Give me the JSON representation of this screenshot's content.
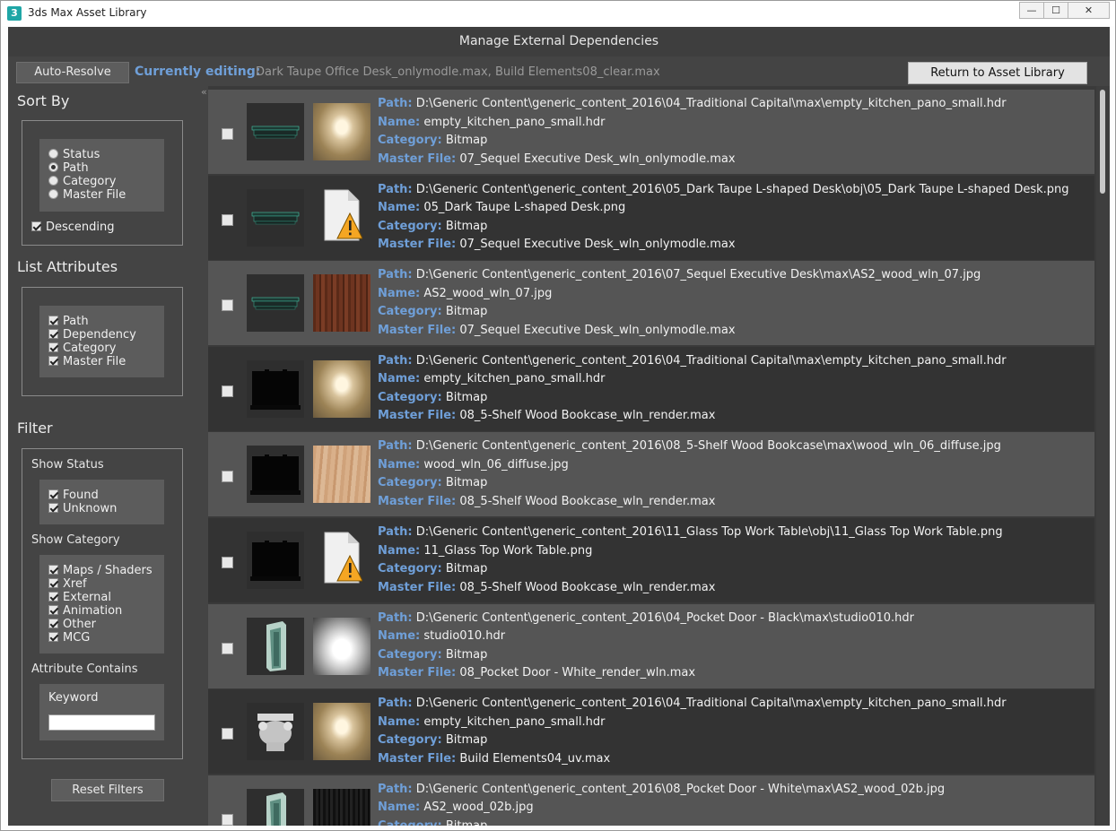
{
  "window": {
    "title": "3ds Max Asset Library",
    "app_icon": "3",
    "controls": {
      "minimize": "—",
      "maximize": "☐",
      "close": "✕"
    }
  },
  "header": {
    "title": "Manage External Dependencies"
  },
  "toolbar": {
    "auto_resolve_label": "Auto-Resolve",
    "editing_label": "Currently editing:",
    "editing_value": "Dark Taupe Office Desk_onlymodle.max, Build Elements08_clear.max",
    "return_label": "Return to Asset Library"
  },
  "sidebar": {
    "sort_by": {
      "title": "Sort By",
      "options": [
        "Status",
        "Path",
        "Category",
        "Master File"
      ],
      "selected": "Path",
      "descending_label": "Descending"
    },
    "list_attributes": {
      "title": "List Attributes",
      "items": [
        "Path",
        "Dependency",
        "Category",
        "Master File"
      ]
    },
    "filter": {
      "title": "Filter",
      "show_status_label": "Show Status",
      "status_items": [
        "Found",
        "Unknown"
      ],
      "show_category_label": "Show Category",
      "category_items": [
        "Maps / Shaders",
        "Xref",
        "External",
        "Animation",
        "Other",
        "MCG"
      ],
      "attribute_contains_label": "Attribute Contains",
      "keyword_label": "Keyword",
      "keyword_value": "",
      "reset_label": "Reset Filters"
    }
  },
  "list": {
    "collapse_glyph": "«",
    "keys": {
      "path": "Path:",
      "name": "Name:",
      "category": "Category:",
      "master": "Master File:"
    },
    "rows": [
      {
        "path": "D:\\Generic Content\\generic_content_2016\\04_Traditional Capital\\max\\empty_kitchen_pano_small.hdr",
        "name": "empty_kitchen_pano_small.hdr",
        "category": "Bitmap",
        "master": "07_Sequel Executive Desk_wln_onlymodle.max",
        "obj": "desk",
        "tex": "pano"
      },
      {
        "path": "D:\\Generic Content\\generic_content_2016\\05_Dark Taupe L-shaped Desk\\obj\\05_Dark Taupe L-shaped Desk.png",
        "name": "05_Dark Taupe L-shaped Desk.png",
        "category": "Bitmap",
        "master": "07_Sequel Executive Desk_wln_onlymodle.max",
        "obj": "desk",
        "tex": "missing"
      },
      {
        "path": "D:\\Generic Content\\generic_content_2016\\07_Sequel Executive Desk\\max\\AS2_wood_wln_07.jpg",
        "name": "AS2_wood_wln_07.jpg",
        "category": "Bitmap",
        "master": "07_Sequel Executive Desk_wln_onlymodle.max",
        "obj": "desk",
        "tex": "wood-dark"
      },
      {
        "path": "D:\\Generic Content\\generic_content_2016\\04_Traditional Capital\\max\\empty_kitchen_pano_small.hdr",
        "name": "empty_kitchen_pano_small.hdr",
        "category": "Bitmap",
        "master": "08_5-Shelf Wood Bookcase_wln_render.max",
        "obj": "bookcase",
        "tex": "pano"
      },
      {
        "path": "D:\\Generic Content\\generic_content_2016\\08_5-Shelf Wood Bookcase\\max\\wood_wln_06_diffuse.jpg",
        "name": "wood_wln_06_diffuse.jpg",
        "category": "Bitmap",
        "master": "08_5-Shelf Wood Bookcase_wln_render.max",
        "obj": "bookcase",
        "tex": "wood-light"
      },
      {
        "path": "D:\\Generic Content\\generic_content_2016\\11_Glass Top Work Table\\obj\\11_Glass Top Work Table.png",
        "name": "11_Glass Top Work Table.png",
        "category": "Bitmap",
        "master": "08_5-Shelf Wood Bookcase_wln_render.max",
        "obj": "bookcase",
        "tex": "missing"
      },
      {
        "path": "D:\\Generic Content\\generic_content_2016\\04_Pocket Door - Black\\max\\studio010.hdr",
        "name": "studio010.hdr",
        "category": "Bitmap",
        "master": "08_Pocket Door - White_render_wln.max",
        "obj": "door",
        "tex": "studio"
      },
      {
        "path": "D:\\Generic Content\\generic_content_2016\\04_Traditional Capital\\max\\empty_kitchen_pano_small.hdr",
        "name": "empty_kitchen_pano_small.hdr",
        "category": "Bitmap",
        "master": "Build Elements04_uv.max",
        "obj": "capital",
        "tex": "pano"
      },
      {
        "path": "D:\\Generic Content\\generic_content_2016\\08_Pocket Door - White\\max\\AS2_wood_02b.jpg",
        "name": "AS2_wood_02b.jpg",
        "category": "Bitmap",
        "master": "",
        "obj": "door",
        "tex": "black-wood"
      }
    ]
  },
  "colors": {
    "panel": "#444444",
    "row_light": "#555555",
    "row_dark": "#333333",
    "key_blue": "#6f9fd8",
    "warning": "#f5a623"
  }
}
